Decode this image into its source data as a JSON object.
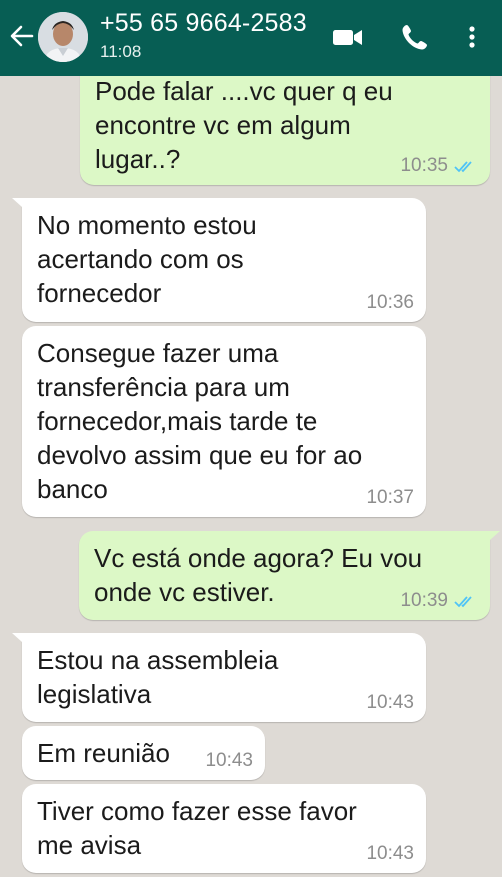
{
  "header": {
    "contact_name": "+55 65 9664-2583",
    "status": "11:08",
    "background_color": "#075e54",
    "icons": [
      "back-arrow-icon",
      "avatar",
      "video-call-icon",
      "phone-icon",
      "more-vert-icon"
    ]
  },
  "colors": {
    "chat_background": "#dedad5",
    "incoming_bubble": "#ffffff",
    "outgoing_bubble": "#dcf8c6",
    "read_ticks": "#4fc3f7"
  },
  "messages": [
    {
      "direction": "outgoing",
      "text": "Pode falar ....vc quer q eu\nencontre vc em algum\nlugar..?",
      "time": "10:35",
      "read": true
    },
    {
      "direction": "incoming",
      "text": "No momento estou\nacertando com os\nfornecedor",
      "time": "10:36"
    },
    {
      "direction": "incoming",
      "text": "Consegue fazer uma\ntransferência para um\nfornecedor,mais tarde te\ndevolvo assim que eu for ao\nbanco",
      "time": "10:37"
    },
    {
      "direction": "outgoing",
      "text": "Vc está onde agora?  Eu vou\nonde vc estiver.",
      "time": "10:39",
      "read": true
    },
    {
      "direction": "incoming",
      "text": "Estou na assembleia\nlegislativa",
      "time": "10:43"
    },
    {
      "direction": "incoming",
      "text": "Em reunião",
      "time": "10:43"
    },
    {
      "direction": "incoming",
      "text": "Tiver como fazer esse favor\nme avisa",
      "time": "10:43"
    }
  ]
}
